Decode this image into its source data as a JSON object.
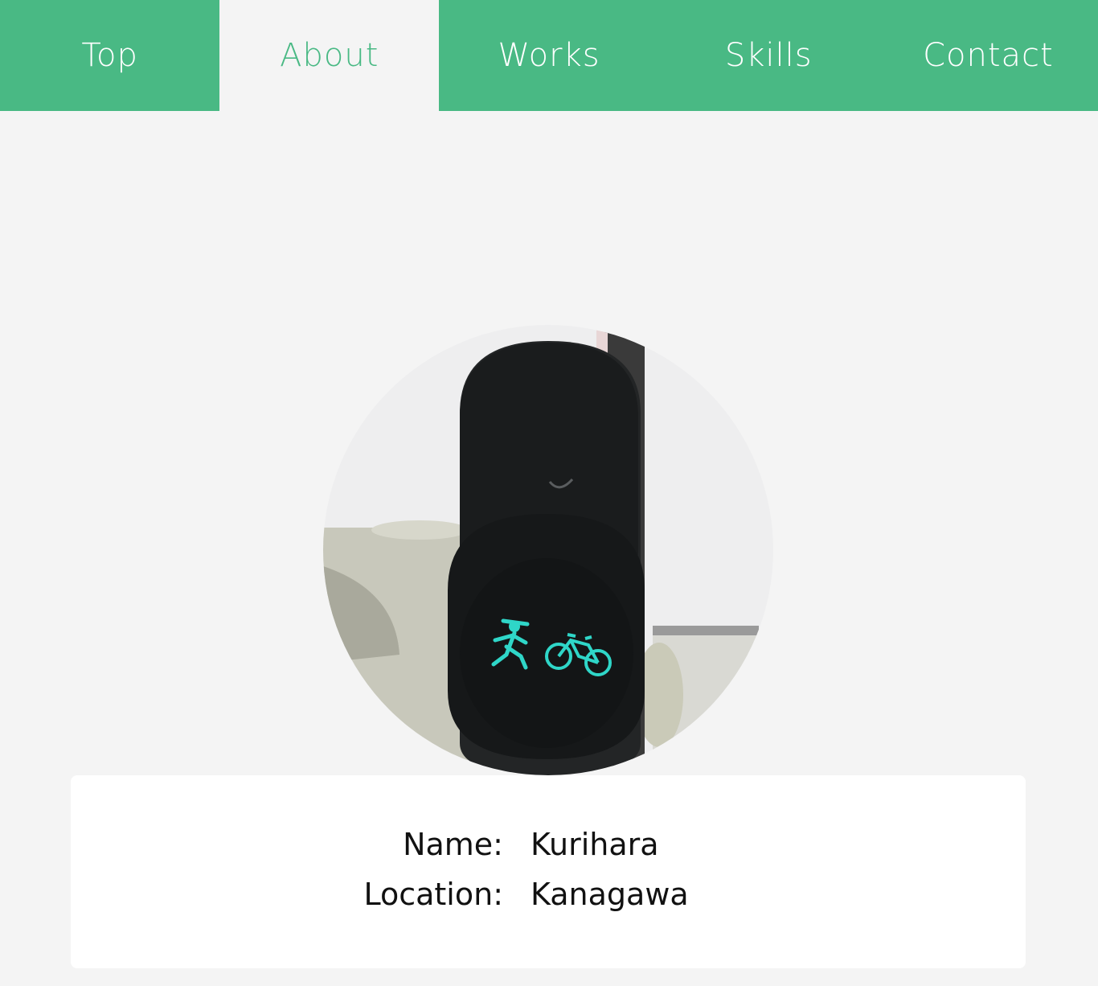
{
  "nav": {
    "items": [
      {
        "label": "Top"
      },
      {
        "label": "About"
      },
      {
        "label": "Works"
      },
      {
        "label": "Skills"
      },
      {
        "label": "Contact"
      }
    ],
    "active_index": 1
  },
  "profile": {
    "photo_subject": "pedestrian-and-bicycle-traffic-signal",
    "name_label": "Name:",
    "name_value": "Kurihara",
    "location_label": "Location:",
    "location_value": "Kanagawa"
  },
  "colors": {
    "accent": "#49b984",
    "background": "#f4f4f4",
    "card": "#ffffff",
    "signal_light": "#2fd6c8"
  }
}
